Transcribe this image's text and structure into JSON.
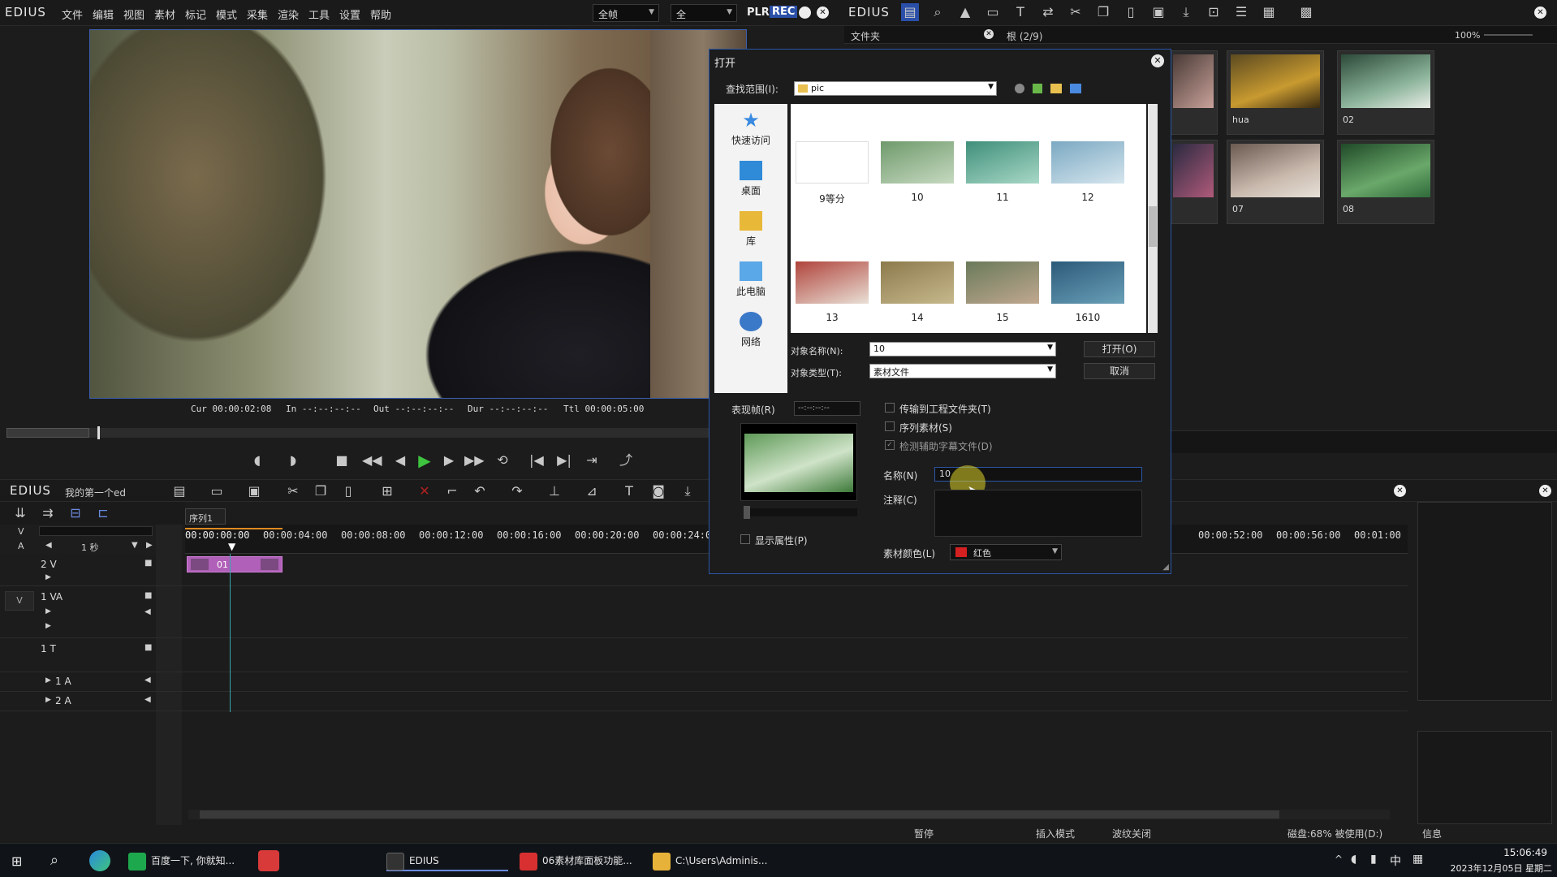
{
  "app": {
    "logo": "EDIUS",
    "menu": [
      "文件",
      "编辑",
      "视图",
      "素材",
      "标记",
      "模式",
      "采集",
      "渲染",
      "工具",
      "设置",
      "帮助"
    ],
    "combo_quality": "全帧",
    "combo_quality2": "全",
    "plr": "PLR",
    "rec": "REC"
  },
  "preview": {
    "cur": "Cur 00:00:02:08",
    "in": "In --:--:--:--",
    "out": "Out --:--:--:--",
    "dur": "Dur --:--:--:--",
    "ttl": "Ttl 00:00:05:00"
  },
  "bin": {
    "logo": "EDIUS",
    "folder_label": "文件夹",
    "root_label": "根 (2/9)",
    "zoom": "100%",
    "thumbs": [
      {
        "label": "hua",
        "color_a": "#a07a2a",
        "color_b": "#5c4a20"
      },
      {
        "label": "02",
        "color_a": "#2c4a38",
        "color_b": "#8bb39a"
      },
      {
        "label": "07",
        "color_a": "#6a5a50",
        "color_b": "#c9b9ad"
      },
      {
        "label": "08",
        "color_a": "#2f6a3a",
        "color_b": "#8ab88a"
      }
    ]
  },
  "dialog": {
    "title": "打开",
    "lookin_label": "查找范围(I):",
    "lookin_value": "pic",
    "places": [
      {
        "label": "快速访问",
        "icon": "star-icon"
      },
      {
        "label": "桌面",
        "icon": "desktop-icon"
      },
      {
        "label": "库",
        "icon": "library-icon"
      },
      {
        "label": "此电脑",
        "icon": "computer-icon"
      },
      {
        "label": "网络",
        "icon": "network-icon"
      }
    ],
    "files": [
      {
        "label": "9等分",
        "c1": "#ffffff",
        "c2": "#eeeeee"
      },
      {
        "label": "10",
        "c1": "#6f9a6c",
        "c2": "#c6d9c0"
      },
      {
        "label": "11",
        "c1": "#3f8f7a",
        "c2": "#a8d8c6"
      },
      {
        "label": "12",
        "c1": "#7aa8c2",
        "c2": "#d6e6ee"
      },
      {
        "label": "13",
        "c1": "#b0443c",
        "c2": "#e9e0d6"
      },
      {
        "label": "14",
        "c1": "#8c7a4c",
        "c2": "#c7b98d"
      },
      {
        "label": "15",
        "c1": "#6a7a5a",
        "c2": "#c0a890"
      },
      {
        "label": "1610",
        "c1": "#2c5a7a",
        "c2": "#6aa0b8"
      }
    ],
    "name_label": "对象名称(N):",
    "name_value": "10",
    "type_label": "对象类型(T):",
    "type_value": "素材文件",
    "open_button": "打开(O)",
    "cancel_button": "取消",
    "poster_label": "表现帧(R)",
    "poster_value": "--:--:--:--",
    "transfer_label": "传输到工程文件夹(T)",
    "sequence_label": "序列素材(S)",
    "detect_label": "检测辅助字幕文件(D)",
    "clipname_label": "名称(N)",
    "clipname_value": "10",
    "comment_label": "注释(C)",
    "showprops_label": "显示属性(P)",
    "color_label": "素材颜色(L)",
    "color_value": "红色",
    "color_swatch": "#d42020"
  },
  "timeline": {
    "logo": "EDIUS",
    "project": "我的第一个ed",
    "seq_tab": "序列1",
    "scale": "1 秒",
    "ruler": [
      "00:00:00:00",
      "00:00:04:00",
      "00:00:08:00",
      "00:00:12:00",
      "00:00:16:00",
      "00:00:20:00",
      "00:00:24:00",
      "00:00:52:00",
      "00:00:56:00",
      "00:01:00"
    ],
    "tracks": [
      {
        "label": "2 V"
      },
      {
        "label": "1 VA"
      },
      {
        "label": "1 T"
      },
      {
        "label": "1 A"
      },
      {
        "label": "2 A"
      }
    ],
    "clip_label": "01",
    "v_tag": "V",
    "a_tag": "A"
  },
  "status": {
    "pause": "暂停",
    "insert": "插入模式",
    "ripple": "波纹关闭",
    "disk": "磁盘:68% 被使用(D:)",
    "info": "信息"
  },
  "taskbar": {
    "items": [
      {
        "label": "百度一下, 你就知...",
        "color": "#1ea84e"
      },
      {
        "label": "EDIUS",
        "color": "#333333"
      },
      {
        "label": "06素材库面板功能...",
        "color": "#d83030"
      },
      {
        "label": "C:\\Users\\Adminis...",
        "color": "#e6b23a"
      }
    ],
    "ime": "中",
    "time": "15:06:49",
    "date": "2023年12月05日 星期二"
  }
}
